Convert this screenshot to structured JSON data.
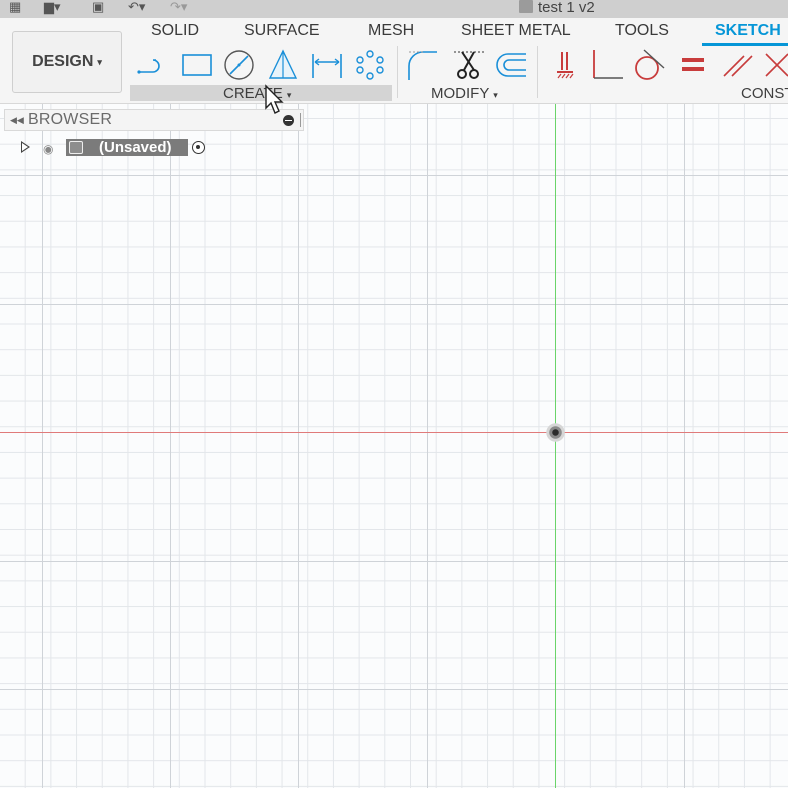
{
  "window": {
    "document_title": "test 1 v2"
  },
  "toolbar": {
    "workspace_label": "DESIGN",
    "tabs": [
      {
        "label": "SOLID",
        "active": false
      },
      {
        "label": "SURFACE",
        "active": false
      },
      {
        "label": "MESH",
        "active": false
      },
      {
        "label": "SHEET METAL",
        "active": false
      },
      {
        "label": "TOOLS",
        "active": false
      },
      {
        "label": "SKETCH",
        "active": true
      }
    ],
    "groups": {
      "create": "CREATE",
      "modify": "MODIFY",
      "constraints": "CONST"
    },
    "create_tools": [
      "line-icon",
      "rectangle-icon",
      "circle-icon",
      "triangle-icon",
      "dimension-icon",
      "pattern-icon"
    ],
    "modify_tools": [
      "fillet-icon",
      "trim-icon",
      "offset-icon"
    ],
    "constraint_tools": [
      "fix-icon",
      "perpendicular-icon",
      "tangent-icon",
      "equal-icon",
      "parallel-icon",
      "intersect-icon"
    ]
  },
  "browser": {
    "title": "BROWSER",
    "root_label": "(Unsaved)"
  },
  "colors": {
    "accent": "#0696d7",
    "x_axis": "#e07a7a",
    "y_axis": "#6ad46a",
    "constraint_red": "#c83c3c",
    "sketch_blue": "#1a8fd8"
  }
}
